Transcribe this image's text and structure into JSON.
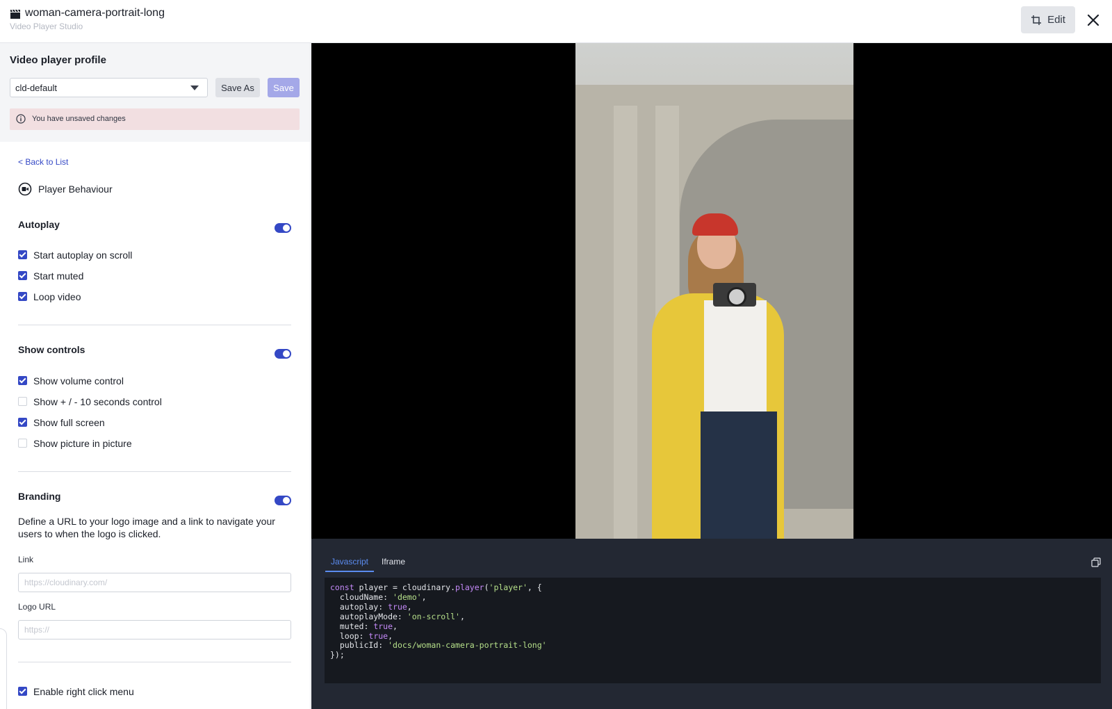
{
  "window": {
    "title": "woman-camera-portrait-long",
    "subtitle": "Video Player Studio",
    "edit_label": "Edit"
  },
  "profile": {
    "heading": "Video player profile",
    "selected": "cld-default",
    "save_as_label": "Save As",
    "save_label": "Save",
    "unsaved_notice": "You have unsaved changes"
  },
  "nav": {
    "back_label": "< Back to List",
    "section_label": "Player Behaviour"
  },
  "autoplay": {
    "title": "Autoplay",
    "enabled": true,
    "options": [
      {
        "label": "Start autoplay on scroll",
        "checked": true
      },
      {
        "label": "Start muted",
        "checked": true
      },
      {
        "label": "Loop video",
        "checked": true
      }
    ]
  },
  "controls": {
    "title": "Show controls",
    "enabled": true,
    "options": [
      {
        "label": "Show volume control",
        "checked": true
      },
      {
        "label": "Show + / - 10 seconds control",
        "checked": false
      },
      {
        "label": "Show full screen",
        "checked": true
      },
      {
        "label": "Show picture in picture",
        "checked": false
      }
    ]
  },
  "branding": {
    "title": "Branding",
    "enabled": true,
    "description": "Define a URL to your logo image and a link to navigate your users to when the logo is clicked.",
    "link_label": "Link",
    "link_placeholder": "https://cloudinary.com/",
    "logo_label": "Logo URL",
    "logo_placeholder": "https://"
  },
  "extra": {
    "right_click_label": "Enable right click menu",
    "right_click_checked": true
  },
  "code": {
    "tabs": [
      "Javascript",
      "Iframe"
    ],
    "active_tab": "Javascript",
    "line1_kw": "const",
    "line1_mid": " player = cloudinary.",
    "line1_fn": "player",
    "line1_open": "(",
    "line1_str": "'player'",
    "line1_end": ", {",
    "props": [
      {
        "key": "cloudName",
        "value": "'demo'",
        "type": "string"
      },
      {
        "key": "autoplay",
        "value": "true",
        "type": "bool"
      },
      {
        "key": "autoplayMode",
        "value": "'on-scroll'",
        "type": "string"
      },
      {
        "key": "muted",
        "value": "true",
        "type": "bool"
      },
      {
        "key": "loop",
        "value": "true",
        "type": "bool"
      },
      {
        "key": "publicId",
        "value": "'docs/woman-camera-portrait-long'",
        "type": "string"
      }
    ],
    "close": "});"
  },
  "colors": {
    "accent": "#3448c5",
    "save_disabled": "#a4a8e8",
    "unsaved_bg": "#f2dfe1",
    "code_bg": "#16191f"
  }
}
